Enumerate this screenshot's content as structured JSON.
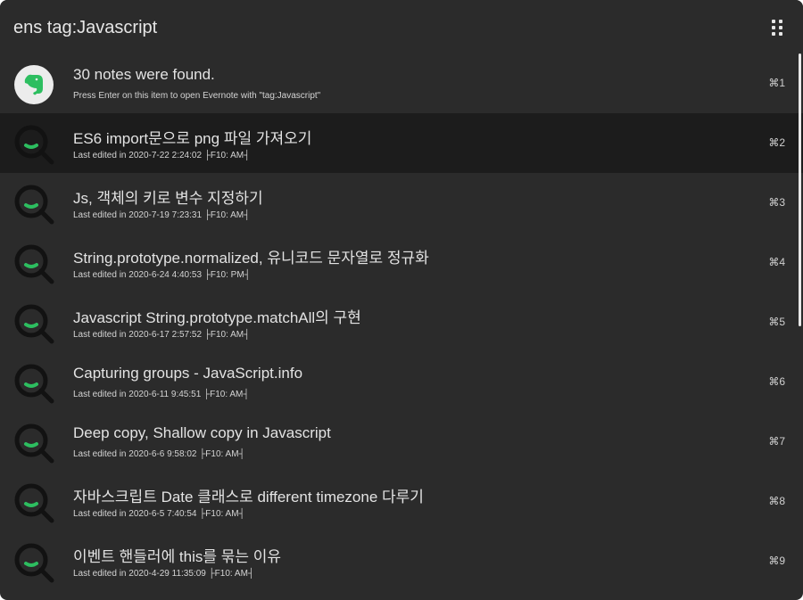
{
  "search": {
    "query": "ens tag:Javascript"
  },
  "colors": {
    "background": "#2b2b2b",
    "selected_row": "#1c1c1c",
    "text": "#e3e3e3",
    "evernote_green": "#2dbe60",
    "magnifier_ring": "#121212"
  },
  "results": [
    {
      "icon": "evernote-elephant-icon",
      "title": "30 notes were found.",
      "subtitle": "Press Enter on this item to open Evernote with \"tag:Javascript\"",
      "shortcut": "⌘1",
      "selected": false
    },
    {
      "icon": "magnifier-icon",
      "title": "ES6 import문으로 png 파일 가져오기",
      "subtitle": "Last edited in 2020-7-22 2:24:02 ├F10: AM┤",
      "shortcut": "⌘2",
      "selected": true
    },
    {
      "icon": "magnifier-icon",
      "title": "Js, 객체의 키로 변수 지정하기",
      "subtitle": "Last edited in 2020-7-19 7:23:31 ├F10: AM┤",
      "shortcut": "⌘3",
      "selected": false
    },
    {
      "icon": "magnifier-icon",
      "title": "String.prototype.normalized, 유니코드 문자열로 정규화",
      "subtitle": "Last edited in 2020-6-24 4:40:53 ├F10: PM┤",
      "shortcut": "⌘4",
      "selected": false
    },
    {
      "icon": "magnifier-icon",
      "title": "Javascript String.prototype.matchAll의 구현",
      "subtitle": "Last edited in 2020-6-17 2:57:52 ├F10: AM┤",
      "shortcut": "⌘5",
      "selected": false
    },
    {
      "icon": "magnifier-icon",
      "title": "Capturing groups - JavaScript.info",
      "subtitle": "Last edited in 2020-6-11 9:45:51 ├F10: AM┤",
      "shortcut": "⌘6",
      "selected": false
    },
    {
      "icon": "magnifier-icon",
      "title": "Deep copy, Shallow copy in Javascript",
      "subtitle": "Last edited in 2020-6-6 9:58:02 ├F10: AM┤",
      "shortcut": "⌘7",
      "selected": false
    },
    {
      "icon": "magnifier-icon",
      "title": "자바스크립트 Date 클래스로 different timezone 다루기",
      "subtitle": "Last edited in 2020-6-5 7:40:54 ├F10: AM┤",
      "shortcut": "⌘8",
      "selected": false
    },
    {
      "icon": "magnifier-icon",
      "title": "이벤트 핸들러에 this를 묶는 이유",
      "subtitle": "Last edited in 2020-4-29 11:35:09 ├F10: AM┤",
      "shortcut": "⌘9",
      "selected": false
    }
  ]
}
